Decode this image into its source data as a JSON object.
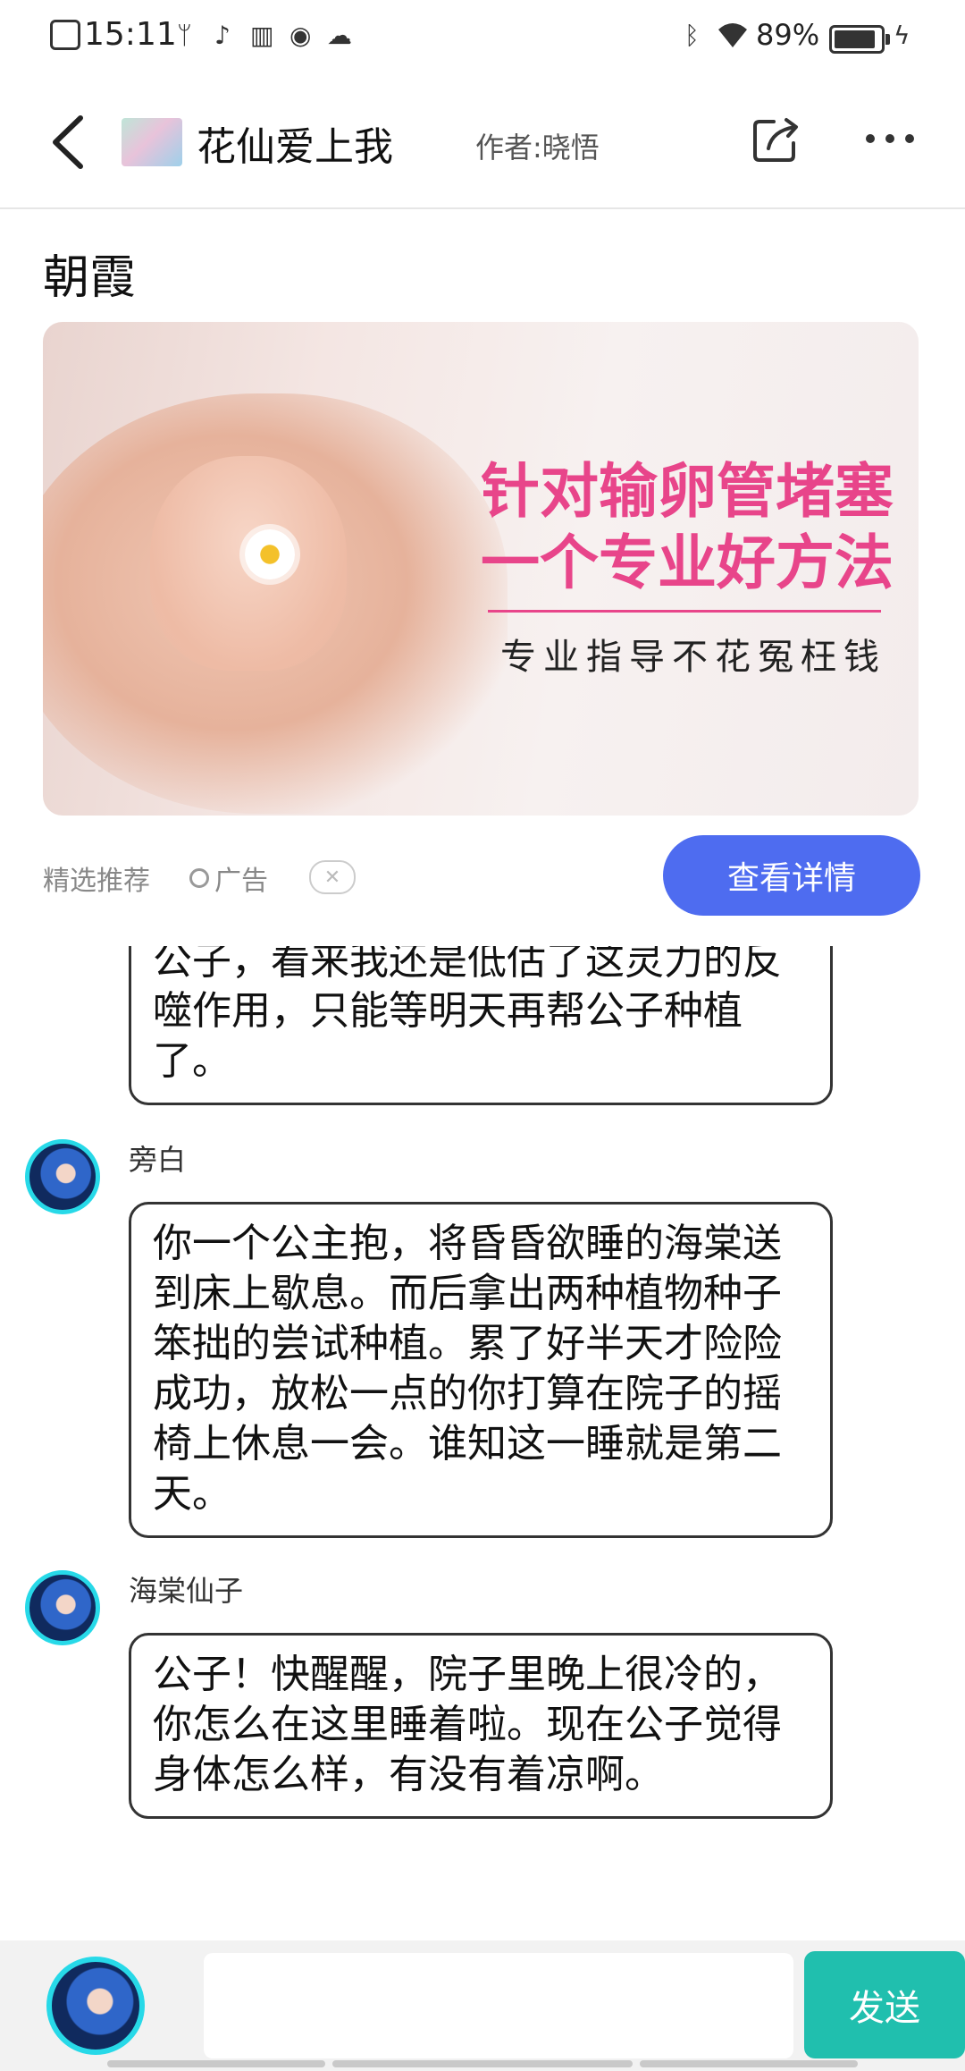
{
  "status_bar": {
    "time": "15:11",
    "battery_percent": "89%",
    "battery_level": 0.89,
    "icons": [
      "notification-icon",
      "usb-icon",
      "tiktok-icon",
      "reader-icon",
      "app-icon",
      "cloud-icon",
      "bluetooth-icon",
      "wifi-icon",
      "charging-icon"
    ]
  },
  "header": {
    "back_icon": "back-icon",
    "book_title": "花仙爱上我",
    "author": "作者:晓悟",
    "share_icon": "share-icon",
    "more_icon": "more-icon"
  },
  "chapter": {
    "title": "朝霞"
  },
  "ad": {
    "headline_line1": "针对输卵管堵塞",
    "headline_line2": "一个专业好方法",
    "subline": "专业指导不花冤枉钱",
    "recommend_label": "精选推荐",
    "ad_label": "广告",
    "close_symbol": "✕",
    "details_button": "查看详情",
    "accent_color": "#e8458a",
    "button_color": "#4e6cf0"
  },
  "messages": [
    {
      "speaker": "",
      "text": "公子，看来我还是低估了这灵力的反噬作用，只能等明天再帮公子种植了。"
    },
    {
      "speaker": "旁白",
      "text": "你一个公主抱，将昏昏欲睡的海棠送到床上歇息。而后拿出两种植物种子笨拙的尝试种植。累了好半天才险险成功，放松一点的你打算在院子的摇椅上休息一会。谁知这一睡就是第二天。"
    },
    {
      "speaker": "海棠仙子",
      "text": "公子！快醒醒，院子里晚上很冷的，你怎么在这里睡着啦。现在公子觉得身体怎么样，有没有着凉啊。"
    }
  ],
  "composer": {
    "input_value": "",
    "send_button": "发送",
    "send_color": "#20bfae"
  }
}
